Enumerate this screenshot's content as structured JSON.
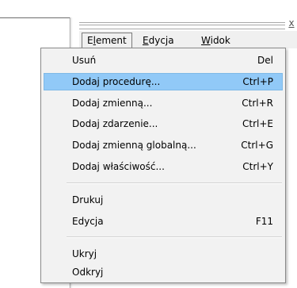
{
  "window": {
    "close_label": "x"
  },
  "menubar": {
    "items": [
      {
        "label_pre": "E",
        "label_mn": "l",
        "label_post": "ement",
        "active": true
      },
      {
        "label_pre": "",
        "label_mn": "E",
        "label_post": "dycja"
      },
      {
        "label_pre": "",
        "label_mn": "W",
        "label_post": "idok"
      }
    ]
  },
  "menu": {
    "highlighted_index": 1,
    "items": [
      {
        "label": "Usuń",
        "shortcut": "Del"
      },
      {
        "label": "Dodaj procedurę...",
        "shortcut": "Ctrl+P"
      },
      {
        "label": "Dodaj zmienną...",
        "shortcut": "Ctrl+R"
      },
      {
        "label": "Dodaj zdarzenie...",
        "shortcut": "Ctrl+E"
      },
      {
        "label": "Dodaj zmienną globalną...",
        "shortcut": "Ctrl+G"
      },
      {
        "label": "Dodaj właściwość...",
        "shortcut": "Ctrl+Y"
      },
      {
        "label": "Drukuj",
        "shortcut": ""
      },
      {
        "label": "Edycja",
        "shortcut": "F11"
      },
      {
        "label": "Ukryj",
        "shortcut": ""
      },
      {
        "label": "Odkryj",
        "shortcut": ""
      }
    ]
  },
  "colors": {
    "highlight": "#91c9f7",
    "menu_background": "#f2f2f2"
  }
}
